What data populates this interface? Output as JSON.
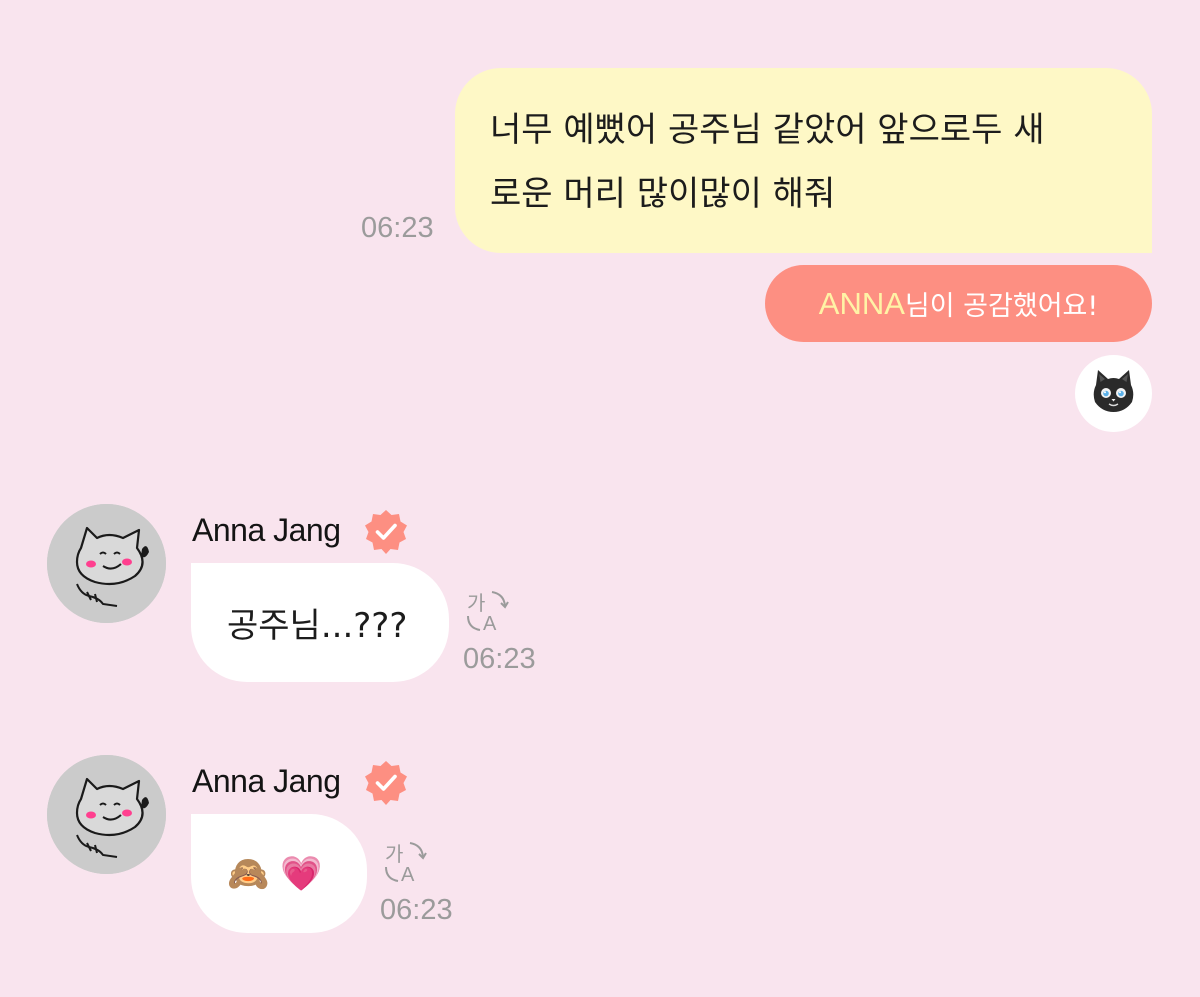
{
  "outgoing_message": {
    "lines": [
      "너무 예뻤어 공주님 같았어 앞으로두 새",
      "로운 머리 많이많이 해줘"
    ],
    "time": "06:23"
  },
  "reaction": {
    "name": "ANNA",
    "text": "님이 공감했어요!",
    "emoji": "🐈‍⬛",
    "reactor_icon": "black-cat-icon"
  },
  "incoming_messages": [
    {
      "sender": "Anna Jang",
      "verified": true,
      "text": "공주님...???",
      "time": "06:23",
      "translate_icon": "translate-icon"
    },
    {
      "sender": "Anna Jang",
      "verified": true,
      "text": "🙈 💗",
      "time": "06:23",
      "translate_icon": "translate-icon"
    }
  ],
  "colors": {
    "background": "#f9e4ee",
    "outgoing_bubble": "#fef8c6",
    "reaction_pill": "#fd8f82",
    "reaction_name": "#fff3a6",
    "verified_badge": "#fd8f82",
    "incoming_bubble": "#ffffff",
    "timestamp": "#9b9b9b"
  }
}
